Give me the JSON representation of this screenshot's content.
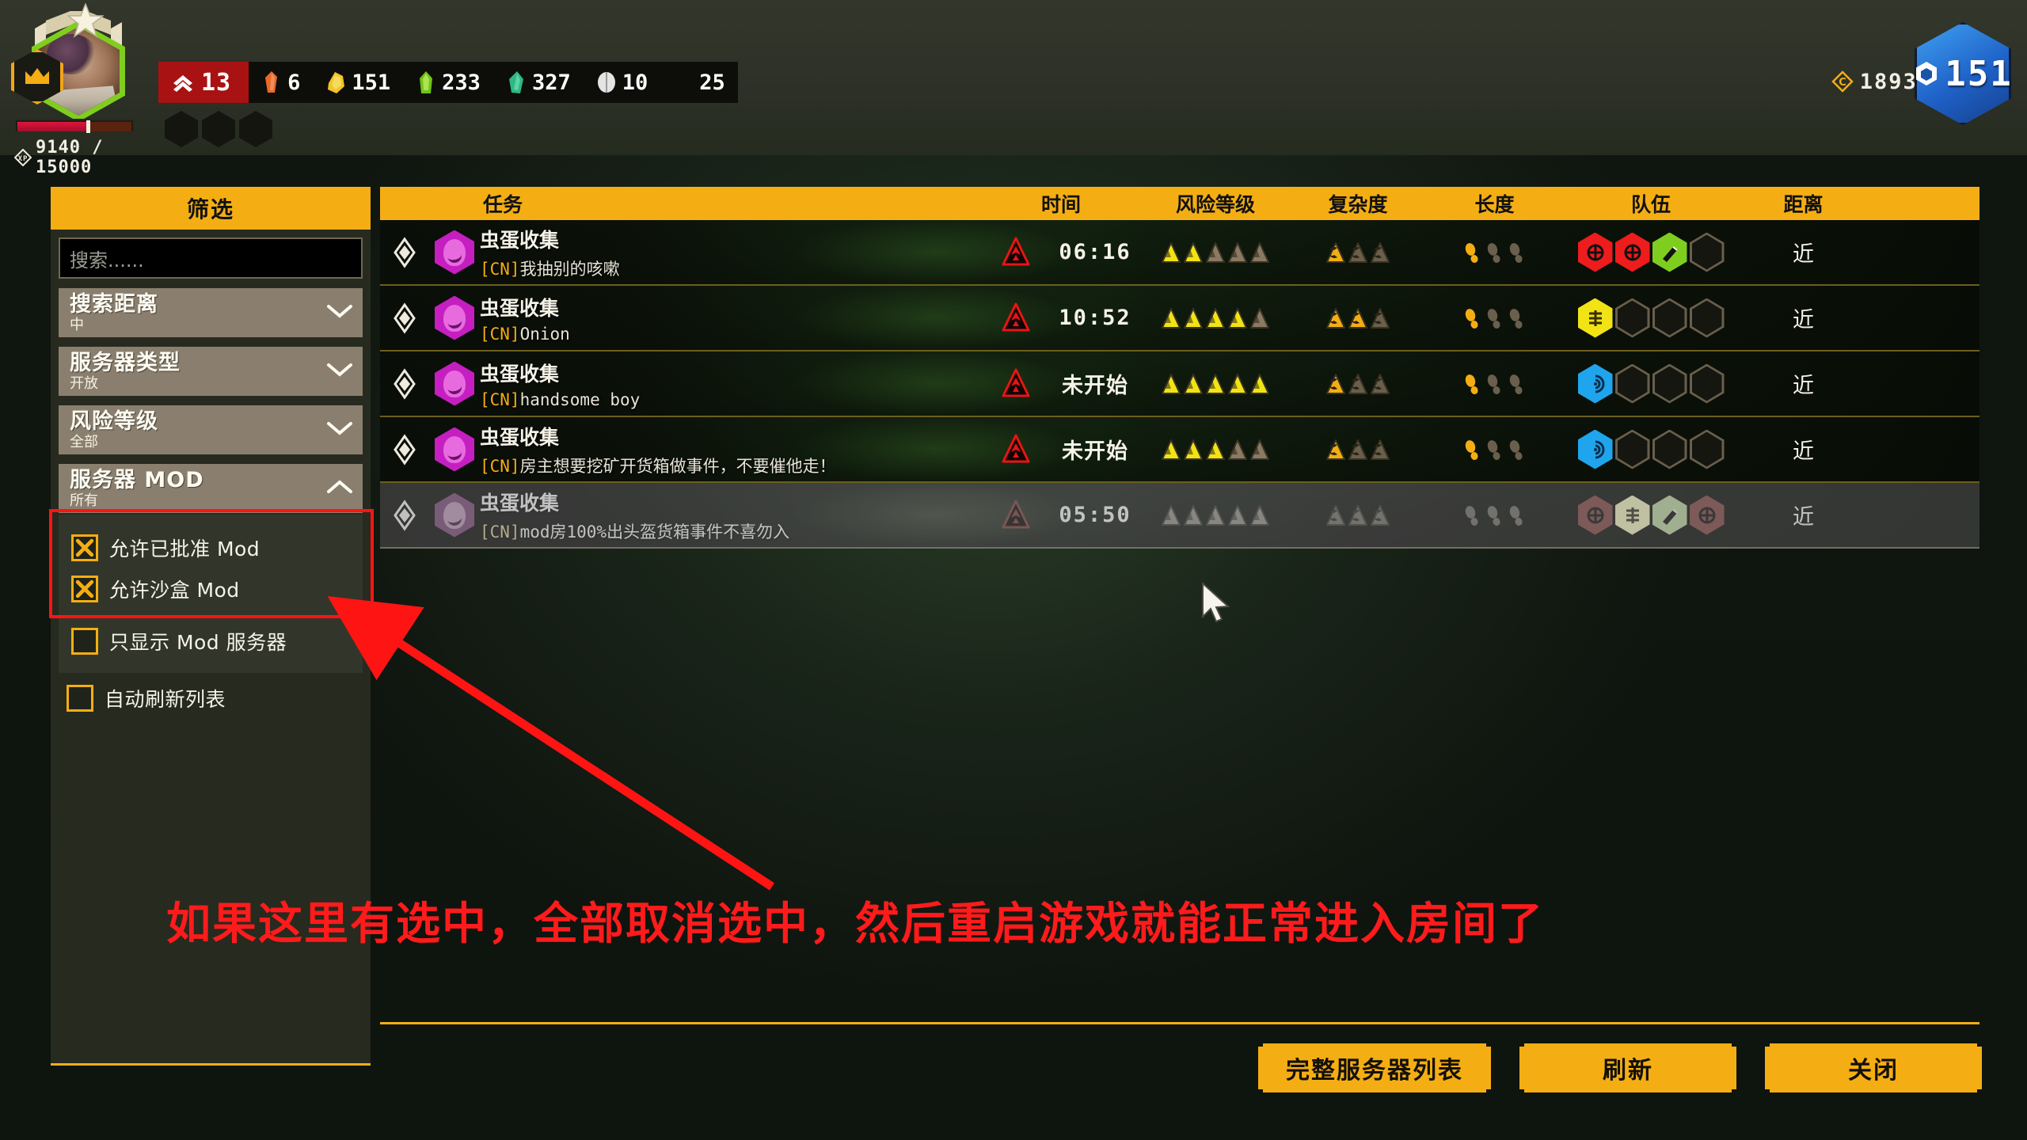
{
  "hud": {
    "level_badge": {
      "icon": "rank-chevron-icon",
      "value": "13"
    },
    "resources": [
      {
        "name": "croppa",
        "icon": "croppa-icon",
        "value": "6",
        "color": "#e8692a"
      },
      {
        "name": "bismor",
        "icon": "bismor-icon",
        "value": "151",
        "color": "#f2c525"
      },
      {
        "name": "umanite",
        "icon": "umanite-icon",
        "value": "233",
        "color": "#6ec418"
      },
      {
        "name": "jadiz",
        "icon": "jadiz-icon",
        "value": "327",
        "color": "#2fb784"
      },
      {
        "name": "magnite",
        "icon": "magnite-icon",
        "value": "10",
        "color": "#e4e4e4"
      },
      {
        "name": "enor",
        "icon": "enor-icon",
        "value": "25",
        "color": "#3bb63b"
      }
    ],
    "xp": {
      "icon": "xp-icon",
      "text": "9140 / 15000",
      "current": 9140,
      "max": 15000,
      "percent": 61
    },
    "credits": {
      "icon": "credits-icon",
      "value": "18933"
    },
    "perk_points": {
      "icon": "perk-point-icon",
      "value": "151"
    }
  },
  "filter": {
    "title": "筛选",
    "search": {
      "placeholder": "搜索......",
      "value": ""
    },
    "dropdowns": [
      {
        "label": "搜索距离",
        "value": "中",
        "icon": "chevron-down-icon",
        "expanded": false
      },
      {
        "label": "服务器类型",
        "value": "开放",
        "icon": "chevron-down-icon",
        "expanded": false
      },
      {
        "label": "风险等级",
        "value": "全部",
        "icon": "chevron-down-icon",
        "expanded": false
      },
      {
        "label": "服务器 MOD",
        "value": "所有",
        "icon": "chevron-up-icon",
        "expanded": true
      }
    ],
    "mod_checkboxes": [
      {
        "label": "允许已批准 Mod",
        "checked": true
      },
      {
        "label": "允许沙盒 Mod",
        "checked": true
      },
      {
        "label": "只显示 Mod 服务器",
        "checked": false
      }
    ],
    "auto_refresh": {
      "label": "自动刷新列表",
      "checked": false
    }
  },
  "annotation": {
    "text": "如果这里有选中，全部取消选中，然后重启游戏就能正常进入房间了",
    "color": "#ff1b1b",
    "highlight_color": "#ff1414"
  },
  "list": {
    "headers": {
      "mission": "任务",
      "time": "时间",
      "hazard": "风险等级",
      "complexity": "复杂度",
      "length": "长度",
      "team": "队伍",
      "distance": "距离"
    },
    "rows": [
      {
        "mission": "虫蛋收集",
        "tag": "[CN]",
        "host": "我抽别的咳嗽",
        "time": "06:16",
        "time_is_cn": false,
        "hazard": 2,
        "hazard_max": 5,
        "complexity": 1,
        "complexity_max": 3,
        "length": 1,
        "length_max": 3,
        "team": [
          "driller",
          "driller",
          "engineer",
          "empty"
        ],
        "distance": "近",
        "dim": false
      },
      {
        "mission": "虫蛋收集",
        "tag": "[CN]",
        "host": "Onion",
        "time": "10:52",
        "time_is_cn": false,
        "hazard": 4,
        "hazard_max": 5,
        "complexity": 2,
        "complexity_max": 3,
        "length": 1,
        "length_max": 3,
        "team": [
          "scout",
          "empty",
          "empty",
          "empty"
        ],
        "distance": "近",
        "dim": false
      },
      {
        "mission": "虫蛋收集",
        "tag": "[CN]",
        "host": "handsome boy",
        "time": "未开始",
        "time_is_cn": true,
        "hazard": 5,
        "hazard_max": 5,
        "complexity": 1,
        "complexity_max": 3,
        "length": 1,
        "length_max": 3,
        "team": [
          "gunner",
          "empty",
          "empty",
          "empty"
        ],
        "distance": "近",
        "dim": false
      },
      {
        "mission": "虫蛋收集",
        "tag": "[CN]",
        "host": "房主想要挖矿开货箱做事件，不要催他走！",
        "time": "未开始",
        "time_is_cn": true,
        "hazard": 3,
        "hazard_max": 5,
        "complexity": 1,
        "complexity_max": 3,
        "length": 1,
        "length_max": 3,
        "team": [
          "gunner",
          "empty",
          "empty",
          "empty"
        ],
        "distance": "近",
        "dim": false
      },
      {
        "mission": "虫蛋收集",
        "tag": "[CN]",
        "host": "mod房100%出头盔货箱事件不喜勿入",
        "time": "05:50",
        "time_is_cn": false,
        "hazard": 0,
        "hazard_max": 5,
        "complexity": 0,
        "complexity_max": 3,
        "length": 0,
        "length_max": 3,
        "team": [
          "driller",
          "scout",
          "engineer",
          "driller"
        ],
        "distance": "近",
        "dim": true
      }
    ]
  },
  "footer": {
    "full_server_list": "完整服务器列表",
    "refresh": "刷新",
    "close": "关闭"
  },
  "colors": {
    "accent": "#f4ae14",
    "panel": "#272a1f",
    "dropdown": "#8a7f6e",
    "hazard_on": "#f2e414",
    "hazard_off": "#8a7a63",
    "complexity_on": "#f4ae14",
    "length_on": "#f4ae14",
    "driller": "#ee1c1c",
    "engineer": "#7fce1f",
    "gunner": "#1fa5ee",
    "scout": "#f2e414"
  }
}
